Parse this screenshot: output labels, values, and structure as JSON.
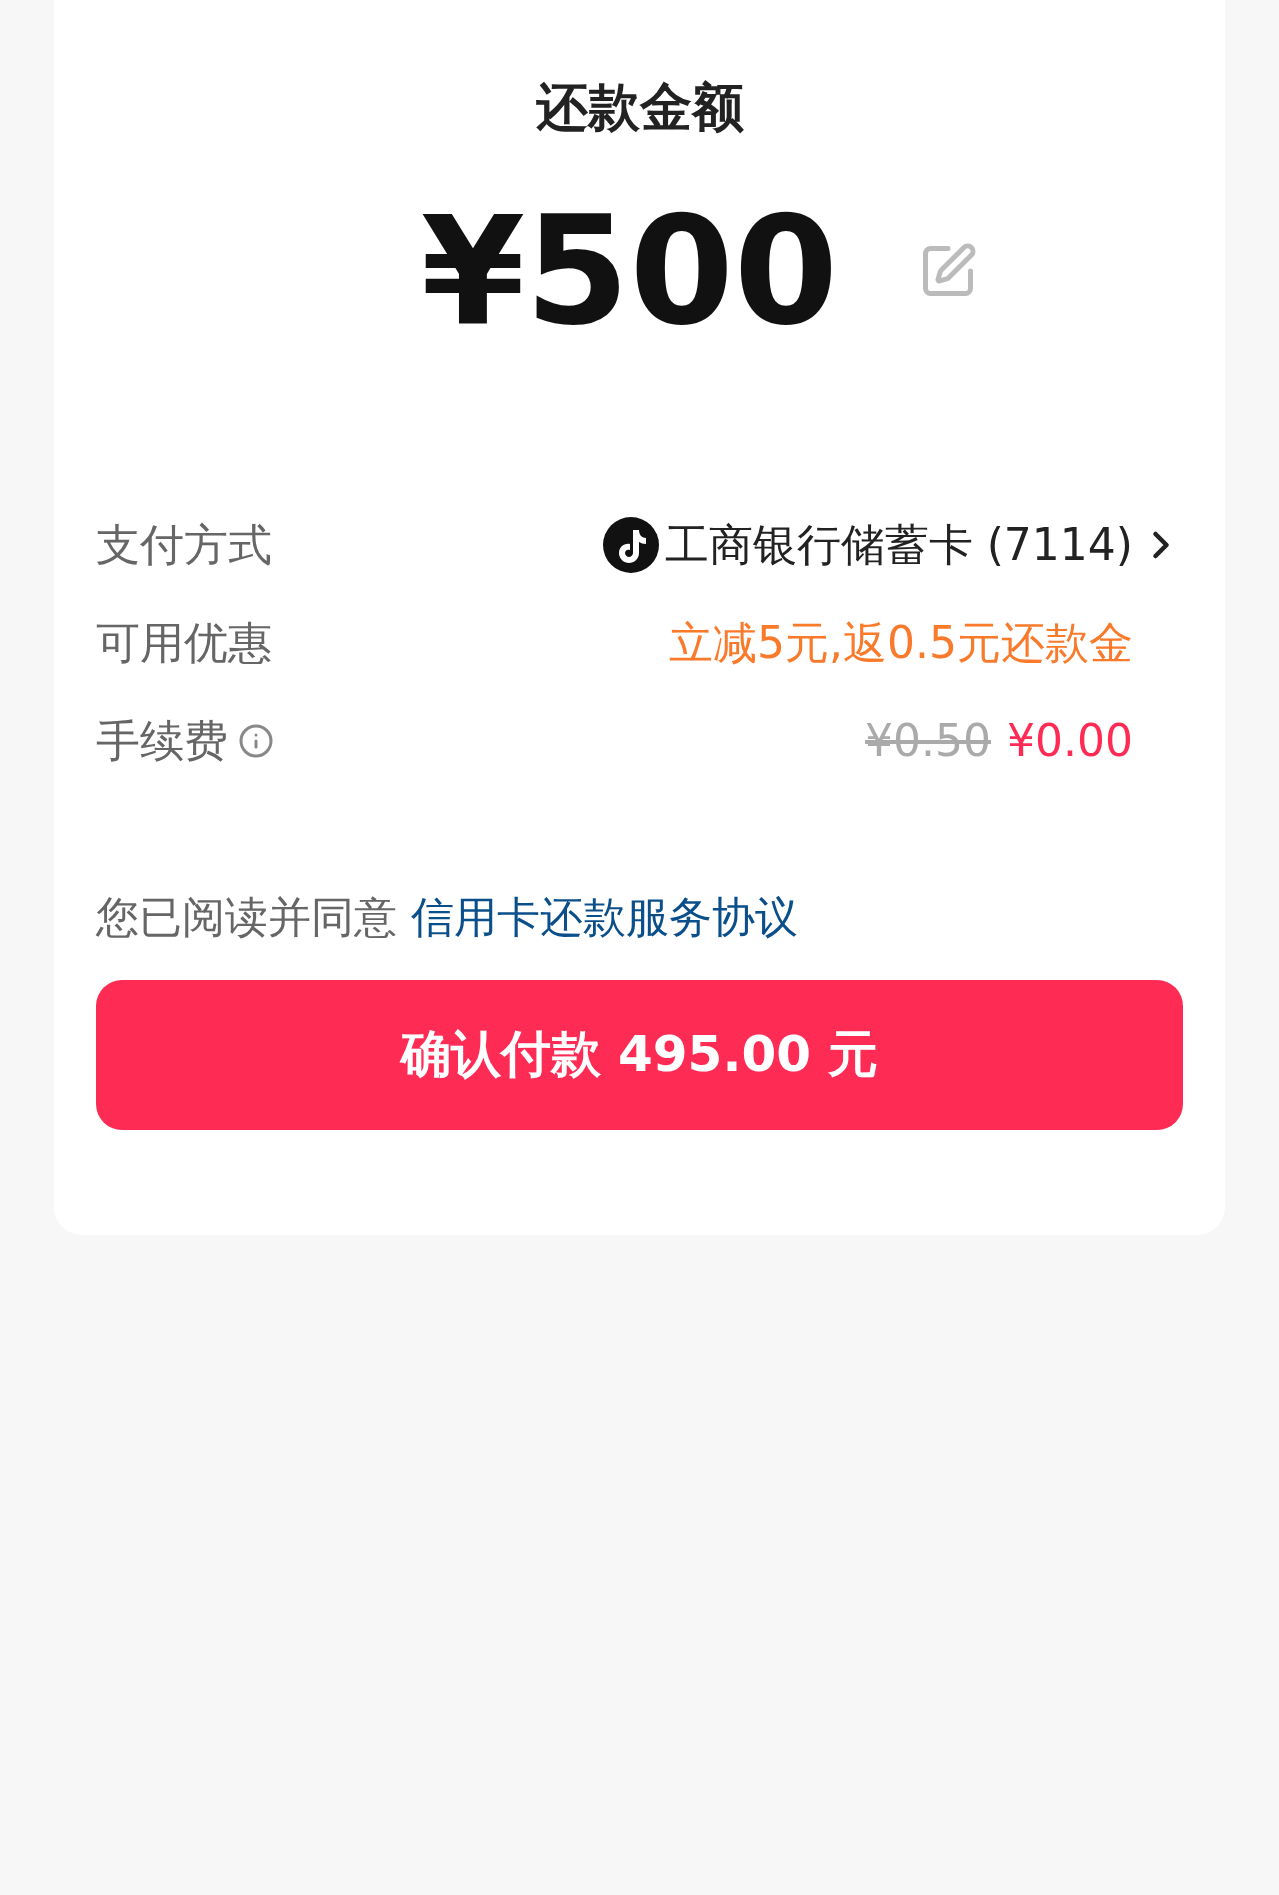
{
  "title": "还款金额",
  "amount": "¥500",
  "rows": [
    {
      "kind": "method",
      "label": "支付方式",
      "value": "工商银行储蓄卡 (7114)"
    },
    {
      "kind": "discount",
      "label": "可用优惠",
      "value": "立减5元,返0.5元还款金"
    },
    {
      "kind": "fee",
      "label": "手续费",
      "original": "¥0.50",
      "value": "¥0.00"
    }
  ],
  "agreement": {
    "text": "您已阅读并同意",
    "link": "信用卡还款服务协议"
  },
  "button": "确认付款 495.00 元"
}
